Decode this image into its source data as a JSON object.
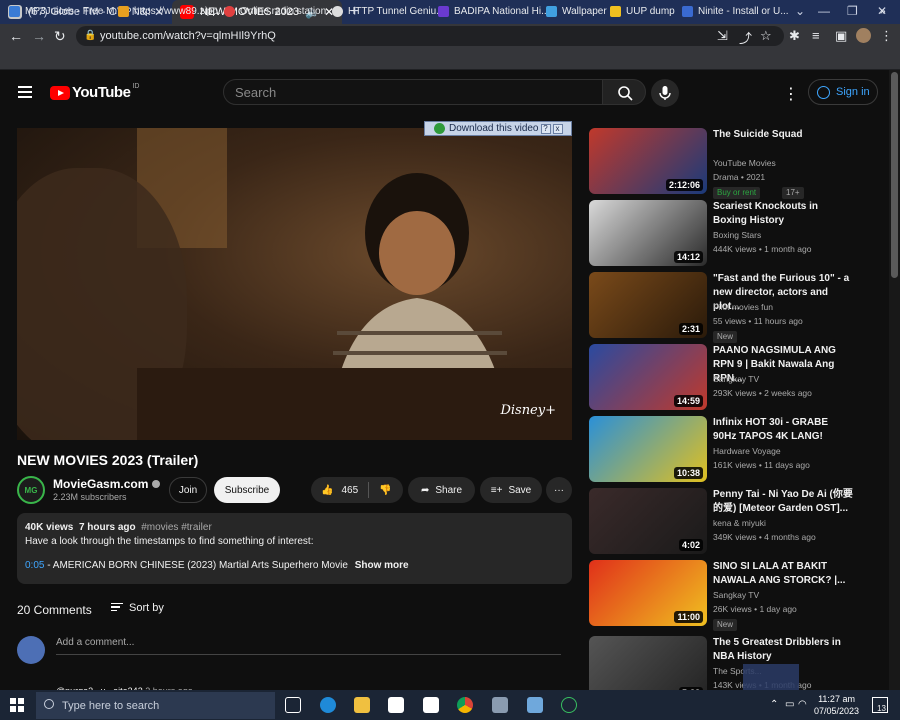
{
  "browser": {
    "tabs": [
      {
        "title": "(67) Globe TM - OVPN&SS Conf",
        "active": false
      },
      {
        "title": "NEW MOVIES 2023 (Trailer)",
        "active": true
      }
    ],
    "url": "youtube.com/watch?v=qlmHIl9YrhQ",
    "bookmarks": [
      "MP3Juices - Free M...",
      "https://www89.zipp...",
      "Online radio station...",
      "HTTP Tunnel Geniu...",
      "BADIPA National Hi...",
      "Wallpaper",
      "UUP dump",
      "Ninite - Install or U..."
    ]
  },
  "youtube": {
    "logo": "YouTube",
    "region": "ID",
    "search_placeholder": "Search",
    "signin": "Sign in",
    "download_bar": "Download this video",
    "video_watermark": "Disney+",
    "video_title": "NEW MOVIES 2023 (Trailer)",
    "channel": {
      "name": "MovieGasm.com",
      "subscribers": "2.23M subscribers",
      "avatar_text": "MG"
    },
    "buttons": {
      "join": "Join",
      "subscribe": "Subscribe",
      "likes": "465",
      "share": "Share",
      "save": "Save"
    },
    "description": {
      "views": "40K views",
      "time": "7 hours ago",
      "tags": "#movies #trailer",
      "line1": "Have a look through the timestamps to find something of interest:",
      "timestamp": "0:05",
      "line2": " - AMERICAN BORN CHINESE (2023) Martial Arts Superhero Movie",
      "show_more": "Show more"
    },
    "comments": {
      "count": "20 Comments",
      "sort": "Sort by",
      "placeholder": "Add a comment...",
      "next_author": "@purge2...u...oite342",
      "next_time": "2 hours ago"
    },
    "recommendations": [
      {
        "title": "The Suicide Squad",
        "channel": "YouTube Movies",
        "meta": "Drama • 2021",
        "duration": "2:12:06",
        "badges": [
          "Buy or rent",
          "17+"
        ],
        "colors": [
          "#c0392b",
          "#1a3a7a"
        ]
      },
      {
        "title": "Scariest Knockouts in Boxing History",
        "channel": "Boxing Stars",
        "meta": "444K views • 1 month ago",
        "duration": "14:12",
        "badges": [],
        "colors": [
          "#d9d9d9",
          "#2a2a2a"
        ]
      },
      {
        "title": "\"Fast and the Furious 10\" - a new director, actors and plot...",
        "channel": "Pilot movies fun",
        "meta": "55 views • 11 hours ago",
        "duration": "2:31",
        "badges": [
          "New"
        ],
        "colors": [
          "#7a4a1a",
          "#2a1a0a"
        ]
      },
      {
        "title": "PAANO NAGSIMULA ANG RPN 9 | Bakit Nawala Ang RPN...",
        "channel": "Sangkay TV",
        "meta": "293K views • 2 weeks ago",
        "duration": "14:59",
        "badges": [],
        "colors": [
          "#2a4aa0",
          "#c0392b"
        ]
      },
      {
        "title": "Infinix HOT 30i - GRABE 90Hz TAPOS 4K LANG!",
        "channel": "Hardware Voyage",
        "meta": "161K views • 11 days ago",
        "duration": "10:38",
        "badges": [],
        "colors": [
          "#2a90d8",
          "#e0c020"
        ]
      },
      {
        "title": "Penny Tai - Ni Yao De Ai (你要的爱) [Meteor Garden OST]...",
        "channel": "kena & miyuki",
        "meta": "349K views • 4 months ago",
        "duration": "4:02",
        "badges": [],
        "colors": [
          "#3a2a2a",
          "#1a1a1a"
        ]
      },
      {
        "title": "SINO SI LALA AT BAKIT NAWALA ANG STORCK? |...",
        "channel": "Sangkay TV",
        "meta": "26K views • 1 day ago",
        "duration": "11:00",
        "badges": [
          "New"
        ],
        "colors": [
          "#e0301a",
          "#f0c020"
        ]
      },
      {
        "title": "The 5 Greatest Dribblers in NBA History",
        "channel": "The Sports...",
        "meta": "143K views • 1 month ago",
        "duration": "5:38",
        "badges": [],
        "colors": [
          "#555555",
          "#222222"
        ]
      }
    ]
  },
  "taskbar": {
    "search_placeholder": "Type here to search",
    "time": "11:27 am",
    "date": "07/05/2023",
    "notification_count": "13"
  }
}
